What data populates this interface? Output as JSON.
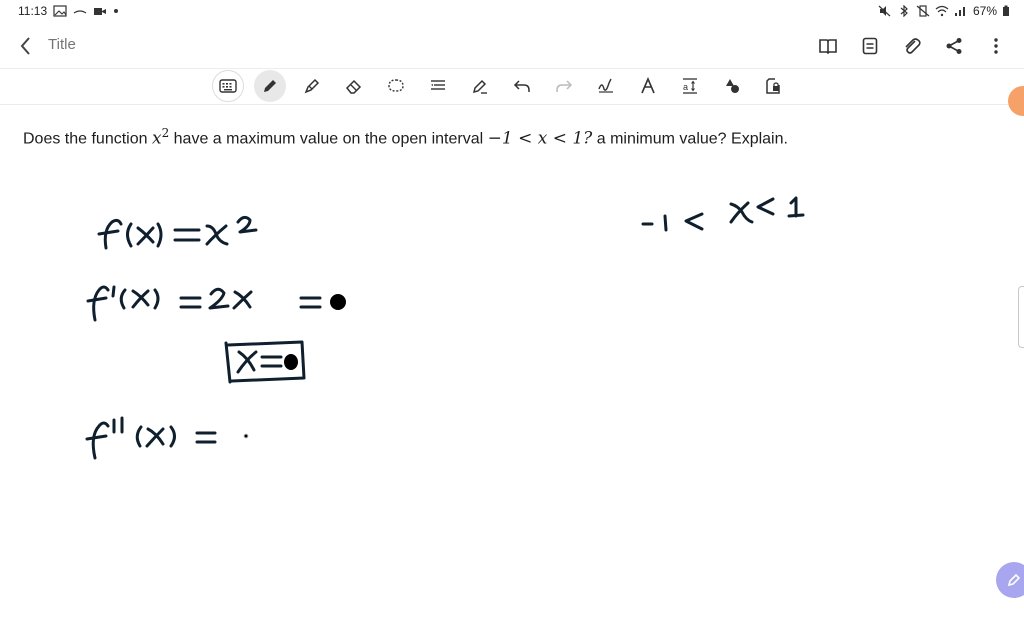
{
  "status_bar": {
    "time": "11:13",
    "left_icons": [
      "image-icon",
      "voicemail-icon",
      "video-icon",
      "dot-icon"
    ],
    "right_icons": [
      "mute-icon",
      "bluetooth-icon",
      "vibrate-icon",
      "wifi-icon",
      "signal-icon"
    ],
    "battery": "67%"
  },
  "app_bar": {
    "title_placeholder": "Title",
    "actions": [
      "book-icon",
      "document-icon",
      "attach-icon",
      "share-icon",
      "more-icon"
    ]
  },
  "toolbar": {
    "tools": [
      "keyboard-icon",
      "pen-icon",
      "highlighter-icon",
      "eraser-icon",
      "lasso-icon",
      "text-format-icon",
      "pen-settings-icon",
      "undo-icon",
      "redo-icon",
      "handwriting-icon",
      "text-icon",
      "text-resize-icon",
      "shapes-icon",
      "image-lock-icon"
    ],
    "active_tool": "pen-icon"
  },
  "question": {
    "prefix": "Does the function ",
    "var": "x",
    "exp": "2",
    "middle": " have a maximum value on the open interval ",
    "interval": "−1 < x < 1?",
    "suffix": " a minimum value? Explain."
  },
  "handwriting_lines": [
    "f(x) = x²",
    "f'(x) = 2x = 0",
    "x = 0",
    "f''(x) =",
    "-1 < x < 1"
  ],
  "colors": {
    "ink": "#0f1f2e",
    "fab": "#a9a6f0",
    "handle": "#f6a168"
  }
}
